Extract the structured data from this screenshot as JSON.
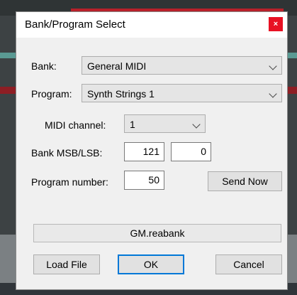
{
  "dialog": {
    "title": "Bank/Program Select",
    "close_label": "×"
  },
  "bank": {
    "label": "Bank:",
    "value": "General MIDI"
  },
  "program": {
    "label": "Program:",
    "value": "Synth Strings 1"
  },
  "midi_channel": {
    "label": "MIDI channel:",
    "value": "1"
  },
  "bank_msb_lsb": {
    "label": "Bank MSB/LSB:",
    "msb": "121",
    "lsb": "0"
  },
  "program_number": {
    "label": "Program number:",
    "value": "50"
  },
  "buttons": {
    "send_now": "Send Now",
    "load_file": "Load File",
    "ok": "OK",
    "cancel": "Cancel"
  },
  "bank_file": "GM.reabank",
  "colors": {
    "close_button": "#e81123",
    "default_button_border": "#0078d7",
    "dialog_bg": "#f0f0f0"
  }
}
